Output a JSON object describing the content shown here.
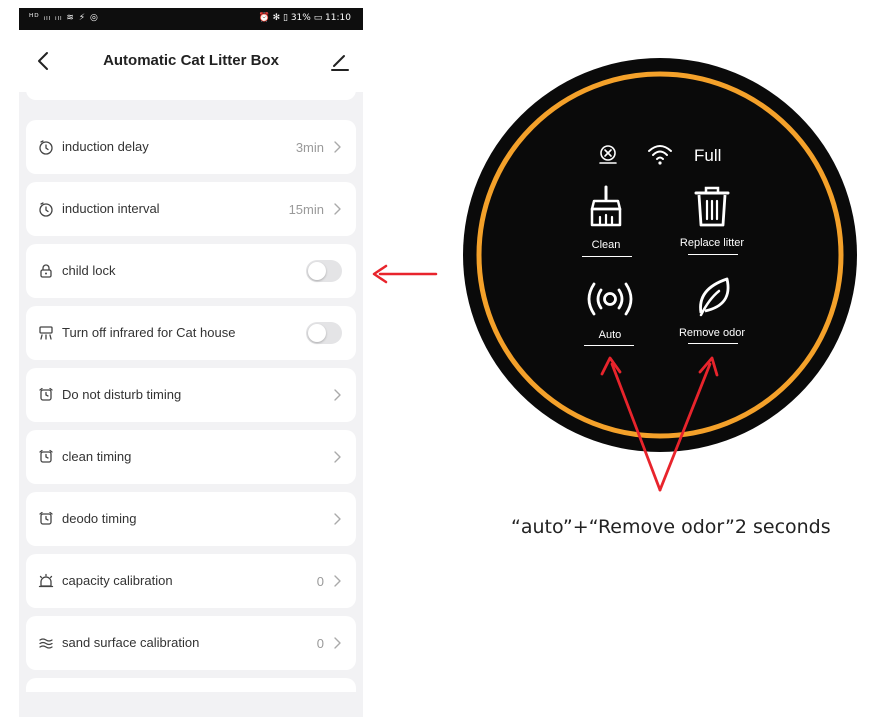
{
  "status_bar": {
    "left": "ᴴᴰ ᵢₗₗ ᵢₗₗ ≋ ⚡ ◎",
    "right": "⏰ ✻ ▯ 31% ▭ 11:10"
  },
  "header": {
    "title": "Automatic Cat Litter Box"
  },
  "settings": [
    {
      "label": "induction delay",
      "value": "3min",
      "icon": "clock-icon",
      "control": "chevron"
    },
    {
      "label": "induction interval",
      "value": "15min",
      "icon": "clock-icon",
      "control": "chevron"
    },
    {
      "label": "child lock",
      "value": "",
      "icon": "lock-icon",
      "control": "toggle"
    },
    {
      "label": "Turn off infrared for Cat house",
      "value": "",
      "icon": "infrared-icon",
      "control": "toggle"
    },
    {
      "label": "Do not disturb timing",
      "value": "",
      "icon": "alarm-icon",
      "control": "chevron"
    },
    {
      "label": "clean timing",
      "value": "",
      "icon": "alarm-icon",
      "control": "chevron"
    },
    {
      "label": "deodo timing",
      "value": "",
      "icon": "alarm-icon",
      "control": "chevron"
    },
    {
      "label": "capacity calibration",
      "value": "0",
      "icon": "bell-icon",
      "control": "chevron"
    },
    {
      "label": "sand surface calibration",
      "value": "0",
      "icon": "waves-icon",
      "control": "chevron"
    }
  ],
  "device_panel": {
    "status_text": "Full",
    "buttons": [
      {
        "label": "Clean",
        "icon": "broom-icon"
      },
      {
        "label": "Replace litter",
        "icon": "trash-icon"
      },
      {
        "label": "Auto",
        "icon": "signal-icon"
      },
      {
        "label": "Remove odor",
        "icon": "leaf-icon"
      }
    ]
  },
  "caption": "“auto”+“Remove odor”2 seconds",
  "colors": {
    "arrow": "#e8242c",
    "ring": "#f4a12a",
    "panel": "#0a0a0a",
    "toggle_off": "#e4e4e6"
  }
}
